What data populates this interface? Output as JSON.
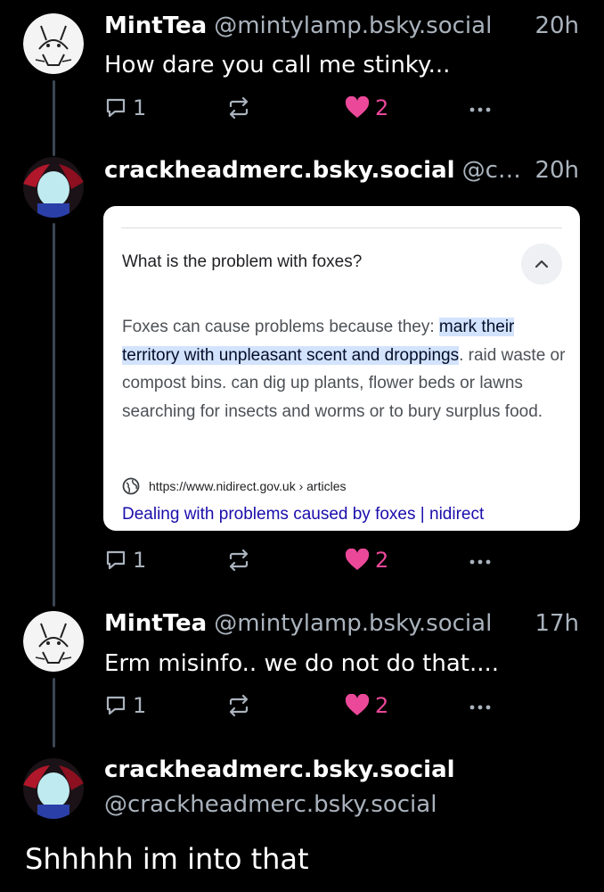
{
  "posts": [
    {
      "name": "MintTea",
      "handle": "@mintylamp.bsky.social",
      "time": "20h",
      "text": "How dare you call me stinky...",
      "replies": "1",
      "likes": "2"
    },
    {
      "name": "crackheadmerc.bsky.social",
      "handle": "@cra...",
      "time": "20h",
      "replies": "1",
      "likes": "2",
      "card": {
        "question": "What is the problem with foxes?",
        "answer_pre": "Foxes can cause problems because they: ",
        "answer_highlight": "mark their territory with unpleasant scent and droppings",
        "answer_post": ". raid waste or compost bins. can dig up plants, flower beds or lawns searching for insects and worms or to bury surplus food.",
        "source_url": "https://www.nidirect.gov.uk › articles",
        "link_title": "Dealing with problems caused by foxes | nidirect"
      }
    },
    {
      "name": "MintTea",
      "handle": "@mintylamp.bsky.social",
      "time": "17h",
      "text": "Erm misinfo.. we do not do that....",
      "replies": "1",
      "likes": "2"
    }
  ],
  "focused": {
    "name": "crackheadmerc.bsky.social",
    "handle": "@crackheadmerc.bsky.social",
    "text": "Shhhhh im into that"
  },
  "colors": {
    "background": "#000000",
    "secondary_text": "#aab3bd",
    "like": "#ec4899",
    "thread_line": "#3b4653",
    "highlight": "#d3e3fd",
    "link": "#1a0dab"
  },
  "icons": [
    "reply-icon",
    "repost-icon",
    "heart-icon",
    "more-icon",
    "globe-icon",
    "chevron-up-icon"
  ]
}
